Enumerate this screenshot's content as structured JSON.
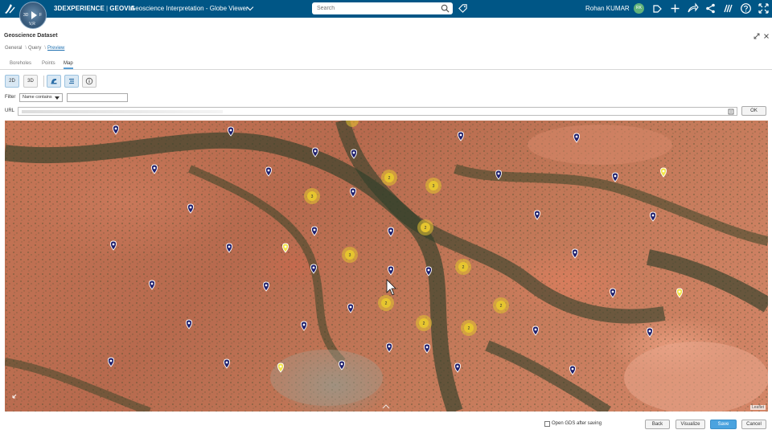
{
  "topbar": {
    "brand_prefix": "3DEXPERIENCE",
    "brand_separator": "|",
    "brand_name": "GEOVIA",
    "app_title": "Geoscience Interpretation - Globe Viewer",
    "compass_3d": "3D",
    "compass_v": "V,R",
    "compass_f": "F",
    "search_placeholder": "Search",
    "user_name": "Rohan KUMAR",
    "user_initials": "RK",
    "accent_color": "#005686"
  },
  "panel": {
    "title": "Geoscience Dataset",
    "breadcrumb": [
      "General",
      "Query",
      "Preview"
    ],
    "breadcrumb_sep": "\\",
    "tabs": [
      "Boreholes",
      "Points",
      "Map"
    ],
    "active_tab": "Map",
    "toolbar": {
      "btn_2d": "2D",
      "btn_3d": "3D"
    },
    "filter": {
      "label": "Filter",
      "select_value": "Name contains",
      "input_value": ""
    },
    "url": {
      "label": "URL",
      "ok_label": "OK"
    }
  },
  "map": {
    "attribution": "Leaflet",
    "cluster_color": "#e6c52f",
    "marker_color": "#1f1f6b",
    "highlight_marker_color": "#f2e54a",
    "clusters": [
      "2",
      "3",
      "3",
      "2",
      "3",
      "2",
      "2",
      "2",
      "2",
      "2"
    ]
  },
  "footer": {
    "checkbox_label": "Open GDS after saving",
    "back": "Back",
    "visualize": "Visualize",
    "save": "Save",
    "cancel": "Cancel"
  }
}
